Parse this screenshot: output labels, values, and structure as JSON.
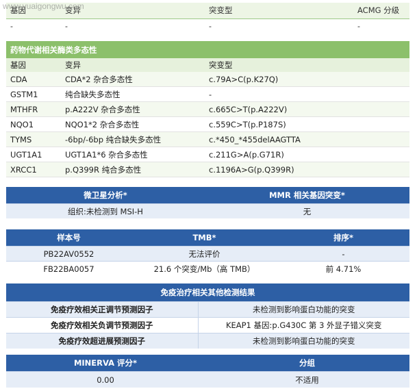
{
  "watermark": "www.yuaigongwu.com",
  "acmg_table": {
    "headers": [
      "基因",
      "变异",
      "突变型",
      "ACMG 分级"
    ],
    "rows": [
      [
        "-",
        "-",
        "-",
        "-"
      ]
    ]
  },
  "pharma_table": {
    "title": "药物代谢相关酶类多态性",
    "headers": [
      "基因",
      "变异",
      "突变型"
    ],
    "rows": [
      [
        "CDA",
        "CDA*2 杂合多态性",
        "c.79A>C(p.K27Q)"
      ],
      [
        "GSTM1",
        "纯合缺失多态性",
        "-"
      ],
      [
        "MTHFR",
        "p.A222V 杂合多态性",
        "c.665C>T(p.A222V)"
      ],
      [
        "NQO1",
        "NQO1*2 杂合多态性",
        "c.559C>T(p.P187S)"
      ],
      [
        "TYMS",
        "-6bp/-6bp 纯合缺失多态性",
        "c.*450_*455delAAGTTA"
      ],
      [
        "UGT1A1",
        "UGT1A1*6 杂合多态性",
        "c.211G>A(p.G71R)"
      ],
      [
        "XRCC1",
        "p.Q399R 纯合多态性",
        "c.1196A>G(p.Q399R)"
      ]
    ]
  },
  "msi_table": {
    "headers": [
      "微卫星分析*",
      "MMR 相关基因突变*"
    ],
    "rows": [
      [
        "组织:未检测到 MSI-H",
        "无"
      ]
    ]
  },
  "tmb_table": {
    "headers": [
      "样本号",
      "TMB*",
      "排序*"
    ],
    "rows": [
      [
        "PB22AV0552",
        "无法评价",
        "-"
      ],
      [
        "FB22BA0057",
        "21.6 个突变/Mb（高 TMB）",
        "前 4.71%"
      ]
    ]
  },
  "immuno_table": {
    "title": "免疫治疗相关其他检测结果",
    "rows": [
      [
        "免疫疗效相关正调节预测因子",
        "未检测到影响蛋白功能的突变"
      ],
      [
        "免疫疗效相关负调节预测因子",
        "KEAP1 基因:p.G430C 第 3 外显子错义突变"
      ],
      [
        "免疫疗效超进展预测因子",
        "未检测到影响蛋白功能的突变"
      ]
    ]
  },
  "minerva_table": {
    "headers": [
      "MINERVA 评分*",
      "分组"
    ],
    "rows": [
      [
        "0.00",
        "不适用"
      ]
    ]
  }
}
